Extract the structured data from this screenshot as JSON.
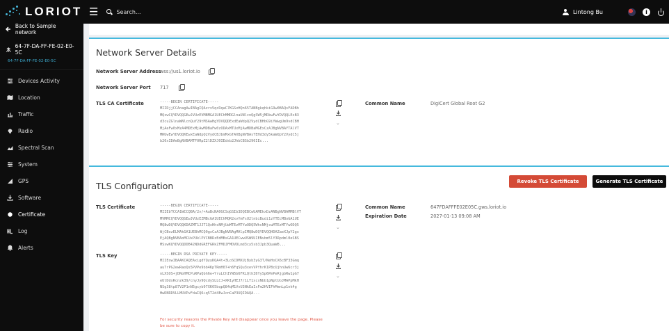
{
  "topbar": {
    "logo_text": "LORIOT",
    "search_placeholder": "Search...",
    "user_name": "Lintong Bu",
    "info_glyph": "i",
    "icons": [
      "menu-icon",
      "search-icon",
      "user-icon",
      "flag-icon",
      "info-icon",
      "power-icon"
    ]
  },
  "sidebar": {
    "back_label": "Back to Sample network",
    "device_name": "64-7F-DA-FF-FE-02-E0-5C",
    "device_id": "64-7F-DA-FF-FE-02-E0-5C",
    "items": [
      {
        "label": "Devices Activity",
        "icon": "devices-icon"
      },
      {
        "label": "Location",
        "icon": "map-icon"
      },
      {
        "label": "Traffic",
        "icon": "traffic-icon"
      },
      {
        "label": "Radio",
        "icon": "radio-icon"
      },
      {
        "label": "Spectral Scan",
        "icon": "spectral-icon"
      },
      {
        "label": "System",
        "icon": "system-icon"
      },
      {
        "label": "GPS",
        "icon": "gps-icon"
      },
      {
        "label": "Software",
        "icon": "software-icon"
      },
      {
        "label": "Certificate",
        "icon": "certificate-icon",
        "active": true
      },
      {
        "label": "Log",
        "icon": "log-icon"
      },
      {
        "label": "Alerts",
        "icon": "alerts-icon"
      }
    ]
  },
  "network_server": {
    "title": "Network Server Details",
    "address_label": "Network Server Address",
    "address_value": "wss://us1.loriot.io",
    "port_label": "Network Server Port",
    "port_value": "717",
    "ca_label": "TLS CA Certificate",
    "ca_text": "-----BEGIN CERTIFICATE-----\nMIIDjjCCAnagAwIBAgIQAzrx5qcRqaC7KGSxHQn65TANBgkqhkiG9w0BAQsFADBh\nMQswCQYDVQQGEwJVUzEVMBMGA1UEChMMRGlnaUNlcnQgSW5jMRkwFwYDVQQLExB3\nd3cuZGlnaWNlcnQuY29tMSAwHgYDVQQDExdEaWdpQ2VydCBHbG9iYWwgUm9vdCBH\nMjAeFw0xMzA4MDExMjAwMDBaFw0zODAxMTUxMjAwMDBaMGExCzAJBgNVBAYTAlVT\nMRUwEwYDVQQKEwxEaWdpQ2VydCBJbmMxGTAXBgNVBAsTEHd3dy5kaWdpY2VydC5j\nb20xIDAeBgNVBAMTF0RpZ2lDZXJ0IEdsb2JhbCBSb290IEc...",
    "common_name_label": "Common Name",
    "common_name_value": "DigiCert Global Root G2"
  },
  "tls_config": {
    "title": "TLS Configuration",
    "revoke_button": "Revoke TLS Certificate",
    "generate_button": "Generate TLS Certificate",
    "cert_label": "TLS Certificate",
    "cert_text": "-----BEGIN CERTIFICATE-----\nMIIEbTCCA1WCCQBA/2v/+AuBcNA0GCSqGSIb3DQEBCwUAMEkxDzANBgNVBAMMBlVT\nMVMMCQYDVQQGEwJVUzEZMBcGA1UEChMQR2xvYmFsU2lnbiBudi1zYTEcMBoGA1UE\nMQ8wDQYDVQQKDAZMT1JJT1QxHhcNMjUwMTEzMTYwODQ5WhcNMjcwMTEzMTYwODQ5\nWjCBozELMAkGA1UEBhMCQ0gxCzAJBgNVBAgMAlpIMQ8wDQYDVQQHDAZaeXJpY2gx\nEjAQBgNVBAoMCUxPUklPVCBBRzEdMBsGA1UECwwUSW9UIENvbm5lY3Rpdml0eSBS\nMSswKQYDVQQDDB42NDdGREFGRkZFMDJFMDVDLmd3cy5sb3Jpb3QuaW8...",
    "common_name_label": "Common Name",
    "common_name_value": "647FDAFFFE02E05C.gws.loriot.io",
    "expiration_label": "Expiration Date",
    "expiration_value": "2027-01-13 09:08 AM",
    "key_label": "TLS Key",
    "key_text": "-----BEGIN RSA PRIVATE KEY-----\nMIIEowIBAAKCAQEAxigdYQyyKQA4t+3LoSCDMXUjByb3yG3T/NeHoCX6cBF33Gmq\nau7rPG2ewRaoQs5PVPe9bb4KpTRmH07+h6FqSQu3xevVPfhrK1PBcUjhnUw6cr3j\nnLXSOS+jDNoHMCPuRPaQbh6e+YruLChIYW5b6FKLQthZ6YySp6PmPeRjgbRw1pG7\neUlDdsRcnzk39/cnyJy9QcdySLLCJ+XR1yHEJ7/1LT1xcxNbb1pNptUoJMAPpMkH\nNSg38tp87V2P1nN5gcyb97XK65bqpQ84qM1VvU3NkEaIxFm2HVIFhMmnLp1nk4g\nHwDNRDVLLMUVPvFdaIQ6+q5T2d4EwJcnCaP3UQIDAQA..."
  },
  "security_notice": "For security reasons the Private Key will disappear once you leave the page. Please be sure to copy it.",
  "colors": {
    "accent": "#45b9dd",
    "sidebar_bg": "#0d0d0d",
    "revoke_button": "#d44a36",
    "warning_text": "#e35a4a"
  }
}
